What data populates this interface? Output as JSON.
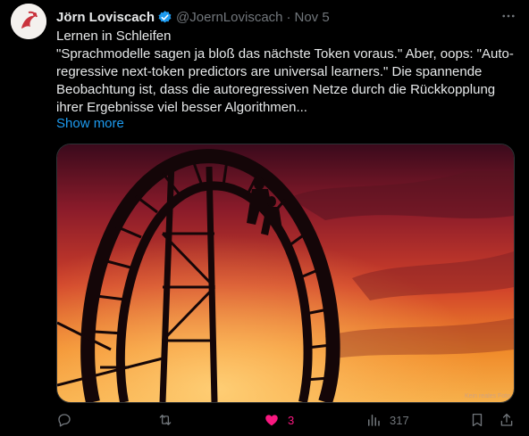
{
  "author": {
    "name": "Jörn Loviscach",
    "handle": "@JoernLoviscach",
    "separator": "·",
    "time": "Nov 5"
  },
  "tweet": {
    "lines": [
      "Lernen in Schleifen",
      "\"Sprachmodelle sagen ja bloß das nächste Token voraus.\" Aber, oops: \"Auto-regressive next-token predictors are universal learners.\" Die spannende Beobachtung ist, dass die autoregressiven Netze durch die Rückkopplung ihrer Ergebnisse viel besser Algorithmen..."
    ],
    "show_more": "Show more"
  },
  "media": {
    "watermark": "Kein reales Foto"
  },
  "actions": {
    "reply_count": "",
    "retweet_count": "",
    "like_count": "3",
    "views_count": "317"
  },
  "colors": {
    "accent": "#1d9bf0",
    "like": "#f91880",
    "muted": "#71767b",
    "text": "#e7e9ea"
  },
  "icons": [
    "verified-badge-icon",
    "more-icon",
    "reply-icon",
    "retweet-icon",
    "like-icon",
    "views-icon",
    "bookmark-icon",
    "share-icon"
  ]
}
